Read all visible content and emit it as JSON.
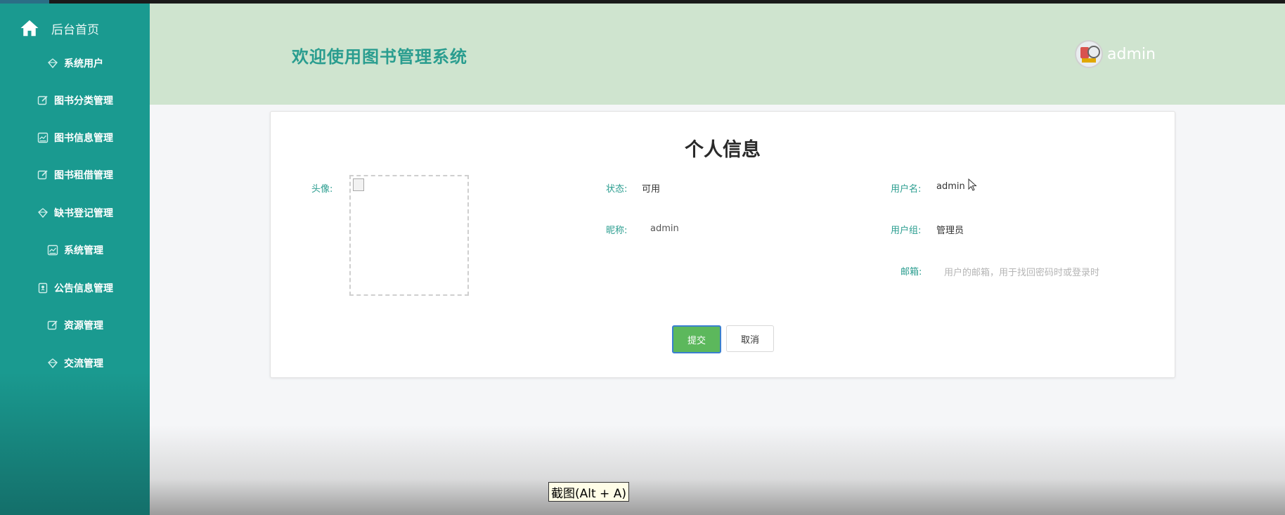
{
  "sidebar": {
    "home_label": "后台首页",
    "items": [
      {
        "label": "系统用户",
        "icon": "diamond-icon"
      },
      {
        "label": "图书分类管理",
        "icon": "edit-icon"
      },
      {
        "label": "图书信息管理",
        "icon": "chart-icon"
      },
      {
        "label": "图书租借管理",
        "icon": "edit-icon"
      },
      {
        "label": "缺书登记管理",
        "icon": "diamond-icon"
      },
      {
        "label": "系统管理",
        "icon": "chart-icon"
      },
      {
        "label": "公告信息管理",
        "icon": "badge-icon"
      },
      {
        "label": "资源管理",
        "icon": "edit-icon"
      },
      {
        "label": "交流管理",
        "icon": "diamond-icon"
      }
    ]
  },
  "header": {
    "title": "欢迎使用图书管理系统",
    "username": "admin"
  },
  "profile": {
    "title": "个人信息",
    "avatar_label": "头像:",
    "status_label": "状态:",
    "status_value": "可用",
    "username_label": "用户名:",
    "username_value": "admin",
    "nickname_label": "昵称:",
    "nickname_value": "admin",
    "group_label": "用户组:",
    "group_value": "管理员",
    "email_label": "邮箱:",
    "email_placeholder": "用户的邮箱，用于找回密码时或登录时",
    "submit_label": "提交",
    "cancel_label": "取消"
  },
  "overlay": {
    "screenshot_tooltip": "截图(Alt + A)"
  },
  "colors": {
    "sidebar": "#1a9a90",
    "header": "#cfe4cf",
    "accent": "#2a9d8f",
    "submit": "#5cb85c"
  }
}
